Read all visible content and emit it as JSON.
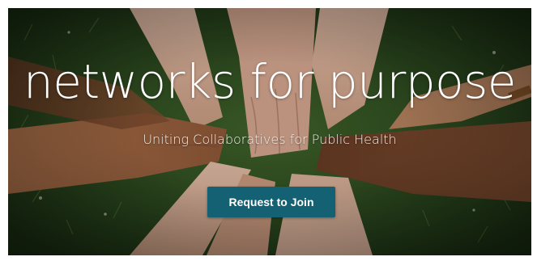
{
  "hero": {
    "headline": "networks for purpose",
    "subtitle": "Uniting Collaboratives for Public Health",
    "background_image": "hands-stacked-in-circle-on-grass"
  },
  "cta": {
    "label": "Request to Join",
    "color": "#146173"
  }
}
